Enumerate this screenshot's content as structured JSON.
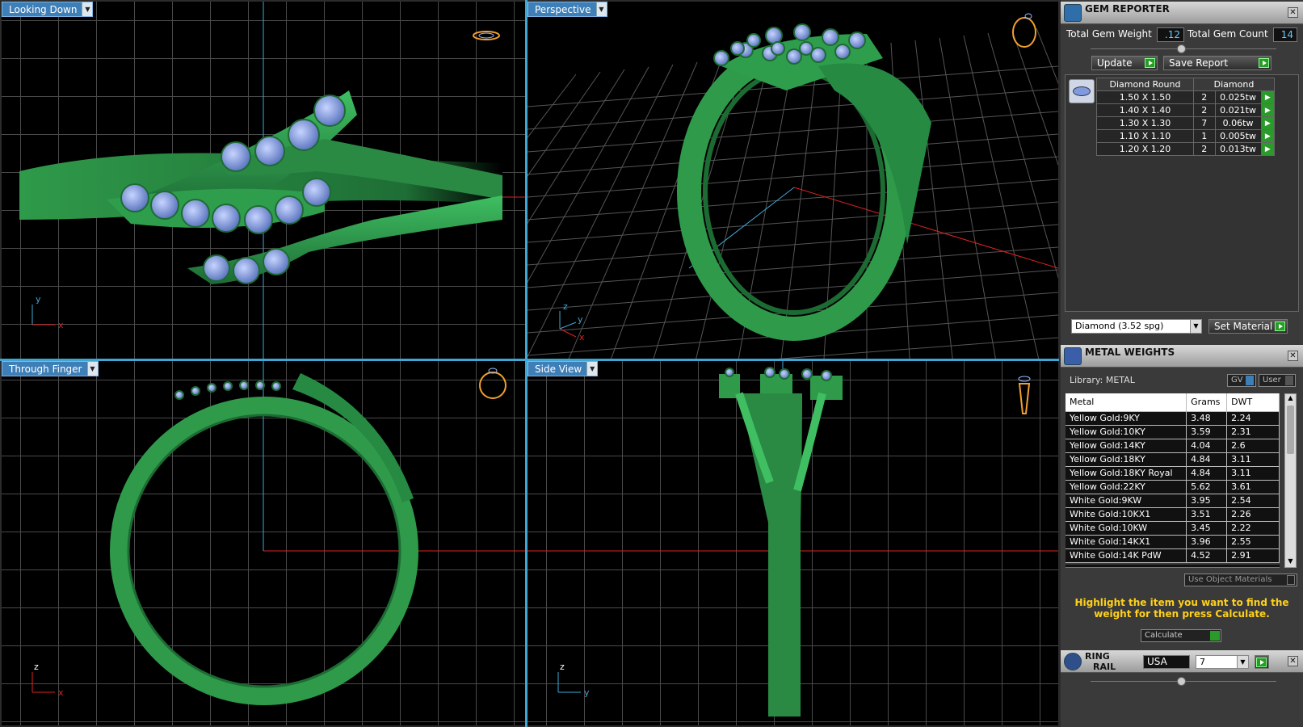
{
  "viewports": {
    "top_left": {
      "label": "Looking Down"
    },
    "top_right": {
      "label": "Perspective"
    },
    "bottom_left": {
      "label": "Through Finger"
    },
    "bottom_right": {
      "label": "Side View"
    }
  },
  "axes": {
    "x": "x",
    "y": "y",
    "z": "z"
  },
  "gem_reporter": {
    "title": "GEM REPORTER",
    "total_weight_label": "Total Gem Weight",
    "total_weight_value": ".12",
    "total_count_label": "Total Gem Count",
    "total_count_value": "14",
    "update_label": "Update",
    "save_report_label": "Save Report",
    "table_headers": [
      "Diamond Round",
      "Diamond"
    ],
    "rows": [
      {
        "size": "1.50 X 1.50",
        "count": "2",
        "weight": "0.025tw"
      },
      {
        "size": "1.40 X 1.40",
        "count": "2",
        "weight": "0.021tw"
      },
      {
        "size": "1.30 X 1.30",
        "count": "7",
        "weight": "0.06tw"
      },
      {
        "size": "1.10 X 1.10",
        "count": "1",
        "weight": "0.005tw"
      },
      {
        "size": "1.20 X 1.20",
        "count": "2",
        "weight": "0.013tw"
      }
    ],
    "material_select": "Diamond    (3.52 spg)",
    "set_material_label": "Set Material"
  },
  "metal_weights": {
    "title": "METAL WEIGHTS",
    "library_label": "Library: METAL",
    "gv_label": "GV",
    "user_label": "User",
    "headers": [
      "Metal",
      "Grams",
      "DWT"
    ],
    "rows": [
      [
        "Yellow Gold:9KY",
        "3.48",
        "2.24"
      ],
      [
        "Yellow Gold:10KY",
        "3.59",
        "2.31"
      ],
      [
        "Yellow Gold:14KY",
        "4.04",
        "2.6"
      ],
      [
        "Yellow Gold:18KY",
        "4.84",
        "3.11"
      ],
      [
        "Yellow Gold:18KY Royal",
        "4.84",
        "3.11"
      ],
      [
        "Yellow Gold:22KY",
        "5.62",
        "3.61"
      ],
      [
        "White Gold:9KW",
        "3.95",
        "2.54"
      ],
      [
        "White Gold:10KX1",
        "3.51",
        "2.26"
      ],
      [
        "White Gold:10KW",
        "3.45",
        "2.22"
      ],
      [
        "White Gold:14KX1",
        "3.96",
        "2.55"
      ],
      [
        "White Gold:14K PdW",
        "4.52",
        "2.91"
      ]
    ],
    "use_object_materials": "Use Object Materials",
    "hint": "Highlight the item you want to find the weight for then press Calculate.",
    "calculate_label": "Calculate"
  },
  "ring_rail": {
    "title_line1": "RING",
    "title_line2": "RAIL",
    "country": "USA",
    "size": "7"
  },
  "colors": {
    "ring": "#2f9a4a",
    "gem": "#7f9bde",
    "grid": "#5a5a5a",
    "accent": "#3f7fb7",
    "hint": "#ffd11a"
  }
}
